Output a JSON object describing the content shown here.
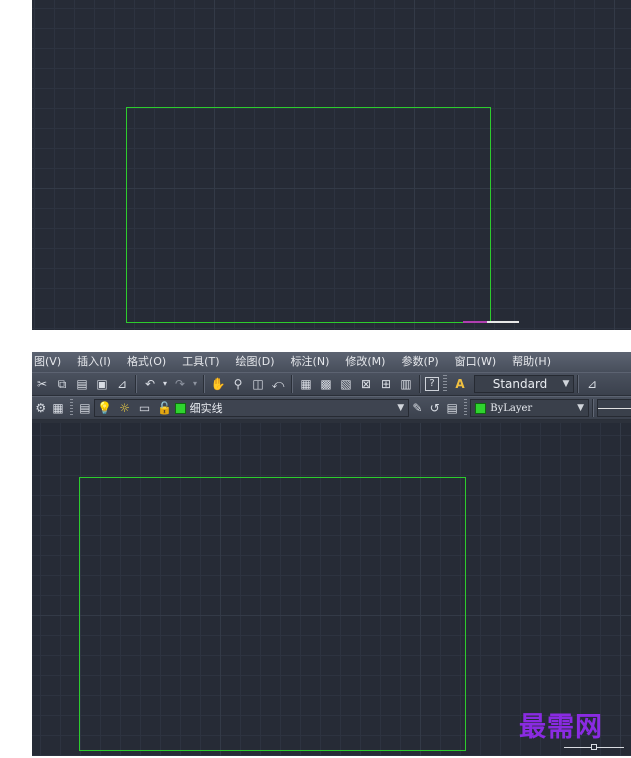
{
  "menu": {
    "items": [
      "图(V)",
      "插入(I)",
      "格式(O)",
      "工具(T)",
      "绘图(D)",
      "标注(N)",
      "修改(M)",
      "参数(P)",
      "窗口(W)",
      "帮助(H)"
    ]
  },
  "toolbar": {
    "text_style": "Standard",
    "layer_name": "细实线",
    "color_value": "ByLayer"
  },
  "colors": {
    "canvas_bg": "#262b36",
    "rectangle": "#2dcc2d",
    "watermark": "#8a2be2"
  },
  "watermark": {
    "text": "最需网"
  }
}
